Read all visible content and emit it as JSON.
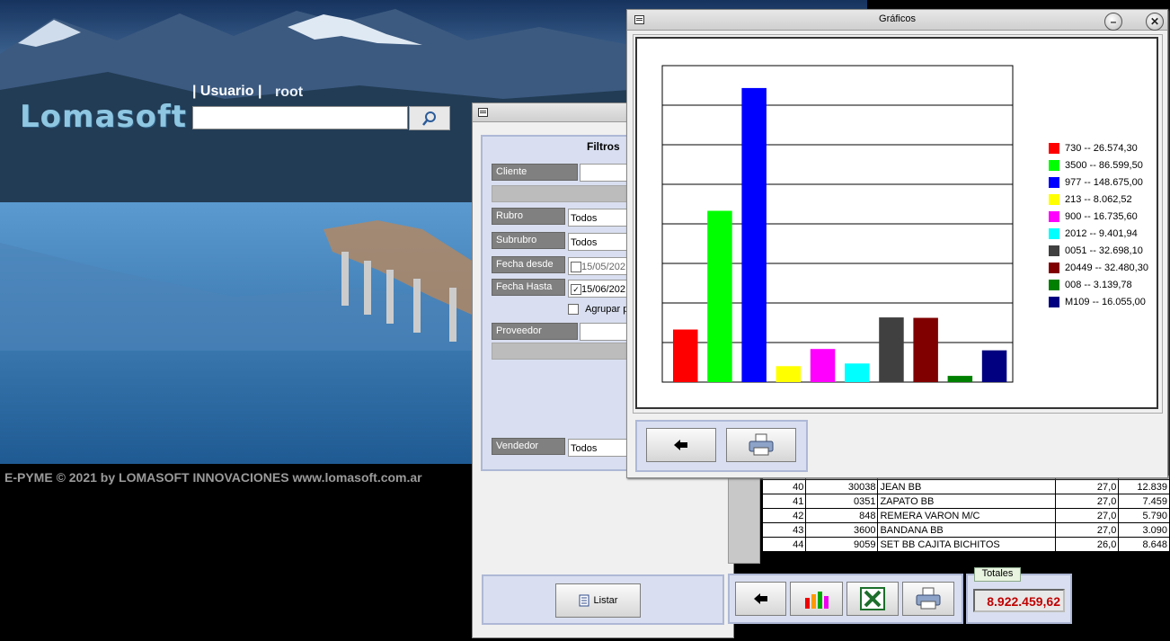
{
  "footer": "E-PYME © 2021 by LOMASOFT INNOVACIONES  www.lomasoft.com.ar",
  "login": {
    "logo": "Lomasoft",
    "user_label": "| Usuario |",
    "user_value": "root",
    "input_value": ""
  },
  "filtros_window": {
    "panel_title": "Filtros",
    "fields": {
      "cliente": {
        "label": "Cliente",
        "value": ""
      },
      "rubro": {
        "label": "Rubro",
        "value": "Todos"
      },
      "subrubro": {
        "label": "Subrubro",
        "value": "Todos"
      },
      "fecha_desde": {
        "label": "Fecha desde",
        "value": "15/05/202",
        "checked": false
      },
      "fecha_hasta": {
        "label": "Fecha Hasta",
        "value": "15/06/202",
        "checked": true
      },
      "agrupar": {
        "label": "Agrupar pc",
        "checked": false
      },
      "proveedor": {
        "label": "Proveedor",
        "value": ""
      },
      "vendedor": {
        "label": "Vendedor",
        "value": "Todos"
      }
    },
    "listar_label": "Listar",
    "table_rows": [
      {
        "num": "40",
        "code": "30038",
        "desc": "JEAN BB",
        "pct": "27,0",
        "amount": "12.839"
      },
      {
        "num": "41",
        "code": "0351",
        "desc": "ZAPATO BB",
        "pct": "27,0",
        "amount": "7.459"
      },
      {
        "num": "42",
        "code": "848",
        "desc": "REMERA VARON M/C",
        "pct": "27,0",
        "amount": "5.790"
      },
      {
        "num": "43",
        "code": "3600",
        "desc": "BANDANA BB",
        "pct": "27,0",
        "amount": "3.090"
      },
      {
        "num": "44",
        "code": "9059",
        "desc": "SET BB CAJITA BICHITOS",
        "pct": "26,0",
        "amount": "8.648"
      }
    ],
    "totales_label": "Totales",
    "totales_value": "8.922.459,62"
  },
  "graficos_window": {
    "title": "Gráficos",
    "minimize_glyph": "–",
    "close_glyph": "✕"
  },
  "chart_data": {
    "type": "bar",
    "title": "",
    "xlabel": "",
    "ylabel": "",
    "ylim": [
      0,
      160000
    ],
    "grid": true,
    "legend_position": "right",
    "categories": [
      "730",
      "3500",
      "977",
      "213",
      "900",
      "2012",
      "0051",
      "20449",
      "008",
      "M109"
    ],
    "values": [
      26574.3,
      86599.5,
      148675.0,
      8062.52,
      16735.6,
      9401.94,
      32698.1,
      32480.3,
      3139.78,
      16055.0
    ],
    "legend": [
      "730 -- 26.574,30",
      "3500 -- 86.599,50",
      "977 -- 148.675,00",
      "213 -- 8.062,52",
      "900 -- 16.735,60",
      "2012 -- 9.401,94",
      "0051 -- 32.698,10",
      "20449 -- 32.480,30",
      "008 -- 3.139,78",
      "M109 -- 16.055,00"
    ],
    "colors": [
      "#ff0000",
      "#00ff00",
      "#0000ff",
      "#ffff00",
      "#ff00ff",
      "#00ffff",
      "#404040",
      "#800000",
      "#008000",
      "#000080"
    ]
  }
}
